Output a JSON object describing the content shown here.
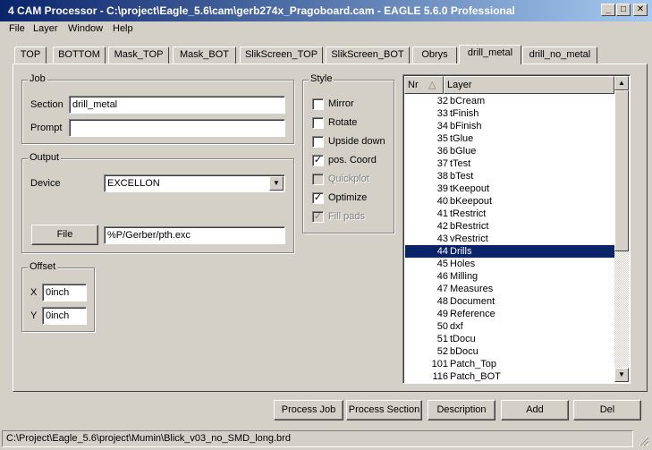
{
  "window": {
    "title": "4 CAM Processor - C:\\project\\Eagle_5.6\\cam\\gerb274x_Pragoboard.cam - EAGLE 5.6.0 Professional",
    "min_icon": "minimize-icon",
    "max_icon": "maximize-icon",
    "close_icon": "close-icon"
  },
  "menu": {
    "file": "File",
    "layer": "Layer",
    "window": "Window",
    "help": "Help"
  },
  "tabs": [
    "TOP",
    "BOTTOM",
    "Mask_TOP",
    "Mask_BOT",
    "SlikScreen_TOP",
    "SlikScreen_BOT",
    "Obrys",
    "drill_metal",
    "drill_no_metal"
  ],
  "active_tab": "drill_metal",
  "job": {
    "group_title": "Job",
    "section_label": "Section",
    "section_value": "drill_metal",
    "prompt_label": "Prompt",
    "prompt_value": ""
  },
  "output": {
    "group_title": "Output",
    "device_label": "Device",
    "device_value": "EXCELLON",
    "file_button": "File",
    "file_value": "%P/Gerber/pth.exc"
  },
  "offset": {
    "group_title": "Offset",
    "x_label": "X",
    "x_value": "0inch",
    "y_label": "Y",
    "y_value": "0inch"
  },
  "style": {
    "group_title": "Style",
    "options": [
      {
        "label": "Mirror",
        "checked": false,
        "enabled": true
      },
      {
        "label": "Rotate",
        "checked": false,
        "enabled": true
      },
      {
        "label": "Upside down",
        "checked": false,
        "enabled": true
      },
      {
        "label": "pos. Coord",
        "checked": true,
        "enabled": true
      },
      {
        "label": "Quickplot",
        "checked": false,
        "enabled": false
      },
      {
        "label": "Optimize",
        "checked": true,
        "enabled": true
      },
      {
        "label": "Fill pads",
        "checked": true,
        "enabled": false
      }
    ]
  },
  "layers": {
    "col_nr": "Nr",
    "col_layer": "Layer",
    "rows": [
      {
        "nr": "32",
        "name": "bCream"
      },
      {
        "nr": "33",
        "name": "tFinish"
      },
      {
        "nr": "34",
        "name": "bFinish"
      },
      {
        "nr": "35",
        "name": "tGlue"
      },
      {
        "nr": "36",
        "name": "bGlue"
      },
      {
        "nr": "37",
        "name": "tTest"
      },
      {
        "nr": "38",
        "name": "bTest"
      },
      {
        "nr": "39",
        "name": "tKeepout"
      },
      {
        "nr": "40",
        "name": "bKeepout"
      },
      {
        "nr": "41",
        "name": "tRestrict"
      },
      {
        "nr": "42",
        "name": "bRestrict"
      },
      {
        "nr": "43",
        "name": "vRestrict"
      },
      {
        "nr": "44",
        "name": "Drills"
      },
      {
        "nr": "45",
        "name": "Holes"
      },
      {
        "nr": "46",
        "name": "Milling"
      },
      {
        "nr": "47",
        "name": "Measures"
      },
      {
        "nr": "48",
        "name": "Document"
      },
      {
        "nr": "49",
        "name": "Reference"
      },
      {
        "nr": "50",
        "name": "dxf"
      },
      {
        "nr": "51",
        "name": "tDocu"
      },
      {
        "nr": "52",
        "name": "bDocu"
      },
      {
        "nr": "101",
        "name": "Patch_Top"
      },
      {
        "nr": "116",
        "name": "Patch_BOT"
      }
    ],
    "selected_nr": "44"
  },
  "buttons": {
    "process_job": "Process Job",
    "process_section": "Process Section",
    "description": "Description",
    "add": "Add",
    "del": "Del"
  },
  "status": {
    "text": "C:\\Project\\Eagle_5.6\\project\\Mumin\\Blick_v03_no_SMD_long.brd"
  }
}
